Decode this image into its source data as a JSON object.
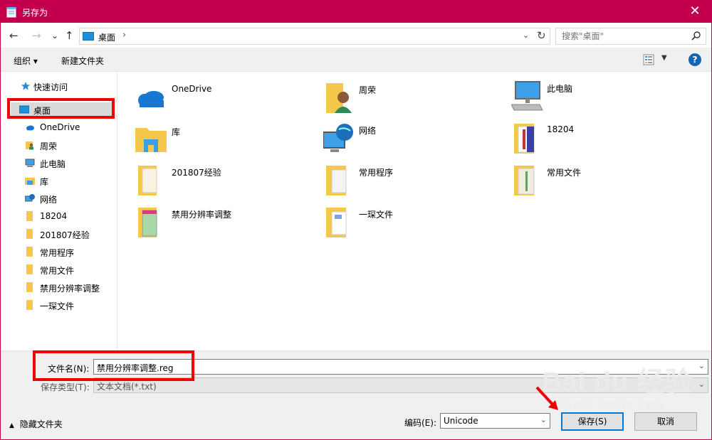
{
  "window": {
    "title": "另存为",
    "close_glyph": "✕",
    "accent_color": "#c4004e"
  },
  "nav": {
    "back_glyph": "←",
    "forward_glyph": "→",
    "recent_glyph": "⌄",
    "up_glyph": "↑",
    "breadcrumb": "桌面",
    "breadcrumb_sep": "›",
    "dropdown_glyph": "⌄",
    "refresh_glyph": "↻",
    "search_placeholder": "搜索\"桌面\""
  },
  "toolbar": {
    "organize_label": "组织 ▾",
    "new_folder_label": "新建文件夹",
    "help_label": "?"
  },
  "sidebar": {
    "items": [
      {
        "label": "快速访问",
        "icon": "star-icon"
      },
      {
        "label": "桌面",
        "icon": "desktop-icon"
      },
      {
        "label": "OneDrive",
        "icon": "cloud-icon"
      },
      {
        "label": "周荣",
        "icon": "user-folder-icon"
      },
      {
        "label": "此电脑",
        "icon": "computer-icon"
      },
      {
        "label": "库",
        "icon": "library-icon"
      },
      {
        "label": "网络",
        "icon": "network-icon"
      },
      {
        "label": "18204",
        "icon": "folder-icon"
      },
      {
        "label": "201807经验",
        "icon": "folder-icon"
      },
      {
        "label": "常用程序",
        "icon": "folder-icon"
      },
      {
        "label": "常用文件",
        "icon": "folder-icon"
      },
      {
        "label": "禁用分辨率调整",
        "icon": "folder-icon"
      },
      {
        "label": "一琛文件",
        "icon": "folder-icon"
      }
    ]
  },
  "content": {
    "items": [
      {
        "label": "OneDrive",
        "icon": "onedrive-icon"
      },
      {
        "label": "周荣",
        "icon": "user-folder-icon"
      },
      {
        "label": "此电脑",
        "icon": "computer-icon"
      },
      {
        "label": "库",
        "icon": "library-icon"
      },
      {
        "label": "网络",
        "icon": "network-icon"
      },
      {
        "label": "18204",
        "icon": "folder-icon"
      },
      {
        "label": "201807经验",
        "icon": "folder-icon"
      },
      {
        "label": "常用程序",
        "icon": "folder-icon"
      },
      {
        "label": "常用文件",
        "icon": "folder-icon"
      },
      {
        "label": "禁用分辨率调整",
        "icon": "folder-icon"
      },
      {
        "label": "一琛文件",
        "icon": "folder-icon"
      }
    ]
  },
  "bottom": {
    "filename_label": "文件名(N):",
    "filename_value": "禁用分辨率调整.reg",
    "filetype_label": "保存类型(T):",
    "filetype_value": "文本文档(*.txt)",
    "encoding_label": "编码(E):",
    "encoding_value": "Unicode",
    "save_label": "保存(S)",
    "cancel_label": "取消",
    "hide_folders_label": "隐藏文件夹",
    "hide_folders_glyph": "▲",
    "dropdown_glyph": "⌄"
  },
  "watermark": {
    "brand": "Bai du 经验",
    "url": "jingyan.baidu.com"
  },
  "colors": {
    "folder": "#f5c84c",
    "selection": "#dadada",
    "highlight_box": "#ee0000",
    "primary_border": "#0078d7"
  }
}
